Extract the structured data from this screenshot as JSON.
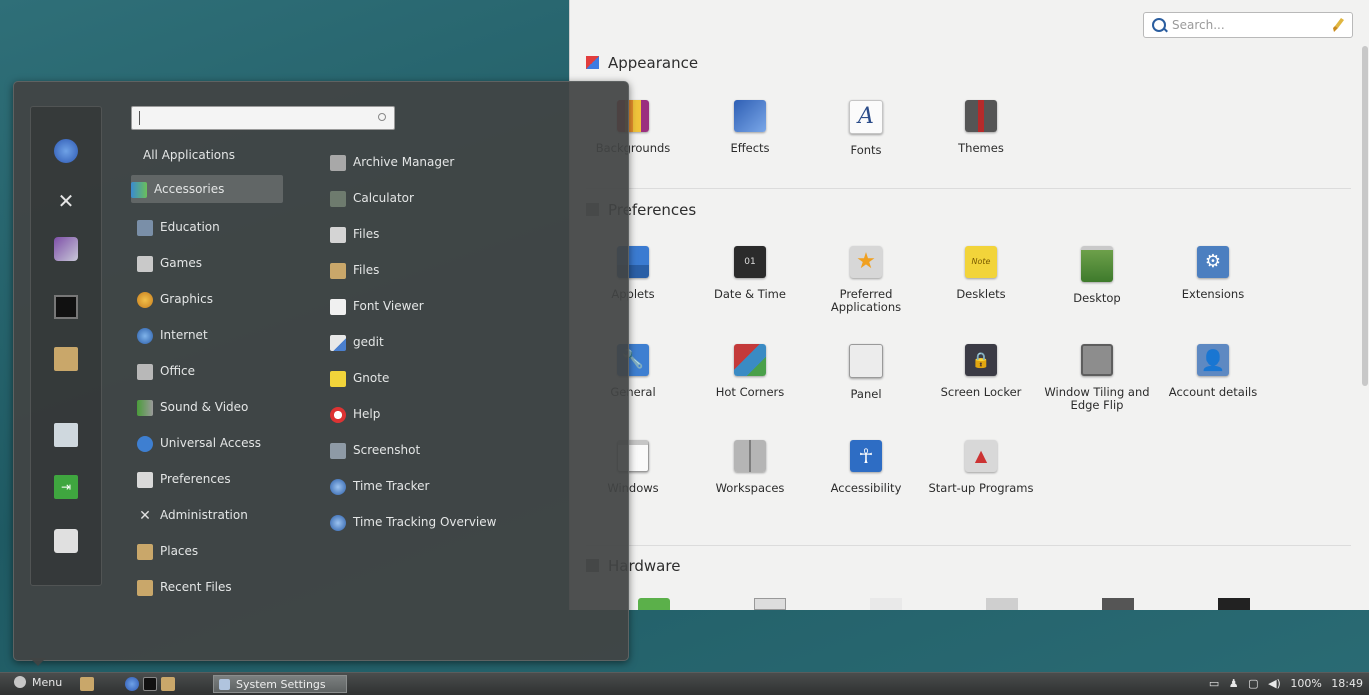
{
  "settings": {
    "search_placeholder": "Search...",
    "categories": [
      {
        "title": "Appearance",
        "items": [
          "Backgrounds",
          "Effects",
          "Fonts",
          "Themes"
        ]
      },
      {
        "title": "Preferences",
        "items": [
          "Applets",
          "Date & Time",
          "Preferred Applications",
          "Desklets",
          "Desktop",
          "Extensions",
          "General",
          "Hot Corners",
          "Panel",
          "Screen Locker",
          "Window Tiling and Edge Flip",
          "Account details",
          "Windows",
          "Workspaces",
          "Accessibility",
          "Start-up Programs"
        ]
      },
      {
        "title": "Hardware",
        "items": []
      }
    ]
  },
  "menu": {
    "all_applications": "All Applications",
    "categories": [
      "Accessories",
      "Education",
      "Games",
      "Graphics",
      "Internet",
      "Office",
      "Sound & Video",
      "Universal Access",
      "Preferences",
      "Administration",
      "Places",
      "Recent Files"
    ],
    "selected_category": "Accessories",
    "apps": [
      "Archive Manager",
      "Calculator",
      "Files",
      "Files",
      "Font Viewer",
      "gedit",
      "Gnote",
      "Help",
      "Screenshot",
      "Time Tracker",
      "Time Tracking Overview"
    ]
  },
  "taskbar": {
    "menu_label": "Menu",
    "window_label": "System Settings",
    "tray_volume": "100%",
    "clock": "18:49"
  },
  "colors": {
    "desktop_bg": "#2a6b74",
    "menu_bg": "#424444",
    "settings_bg": "#f2f2f1"
  }
}
